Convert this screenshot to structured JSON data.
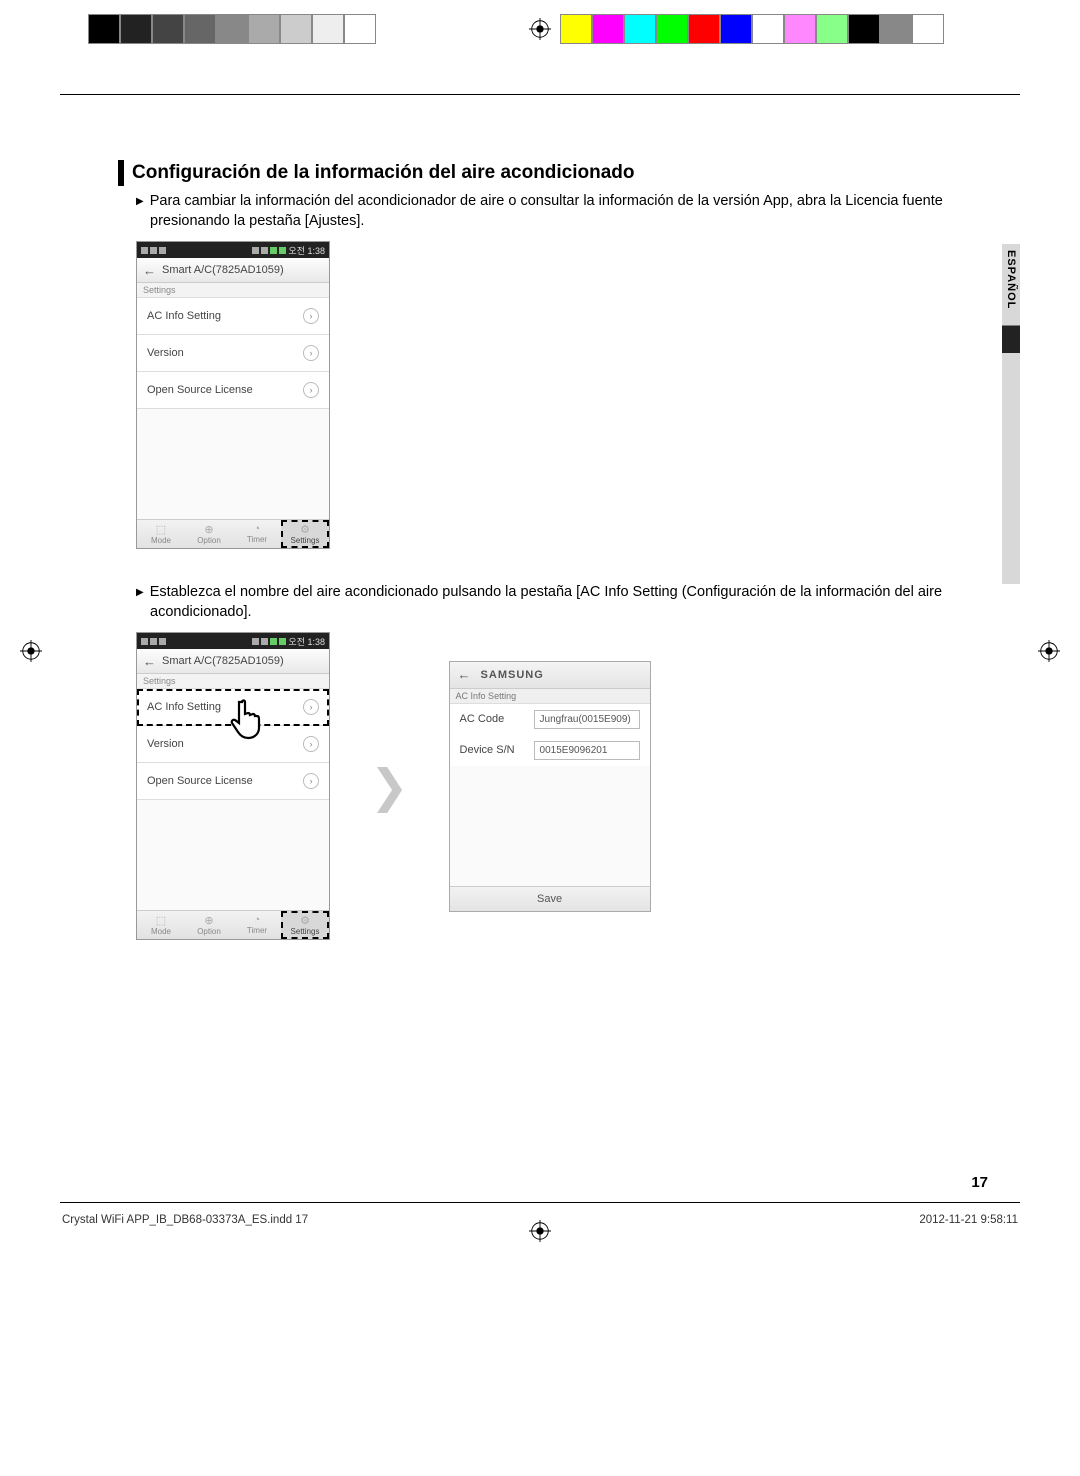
{
  "heading": "Configuración de la información del aire acondicionado",
  "para1": "Para cambiar la información del acondicionador de aire o consultar la información de la versión App, abra la Licencia fuente presionando la pestaña [Ajustes].",
  "para2": "Establezca el nombre del aire acondicionado pulsando la pestaña [AC Info Setting (Configuración de la información del aire acondicionado].",
  "langTab": "ESPAÑOL",
  "pageNum": "17",
  "footerLeft": "Crystal WiFi APP_IB_DB68-03373A_ES.indd   17",
  "footerRight": "2012-11-21   9:58:11",
  "phone": {
    "statusTime": "오전 1:38",
    "title": "Smart A/C(7825AD1059)",
    "subtitle": "Settings",
    "items": [
      "AC Info Setting",
      "Version",
      "Open Source License"
    ],
    "tabs": [
      "Mode",
      "Option",
      "Timer",
      "Settings"
    ]
  },
  "detail": {
    "brand": "SAMSUNG",
    "subtitle": "AC Info Setting",
    "rows": [
      {
        "label": "AC Code",
        "value": "Jungfrau(0015E909)"
      },
      {
        "label": "Device S/N",
        "value": "0015E9096201"
      }
    ],
    "save": "Save"
  },
  "colorbar_left": [
    "#000",
    "#222",
    "#444",
    "#666",
    "#888",
    "#aaa",
    "#ccc",
    "#eee",
    "#fff"
  ],
  "colorbar_right": [
    "#ff0",
    "#f0f",
    "#0ff",
    "#0f0",
    "#f00",
    "#00f",
    "#fff",
    "#f8f",
    "#8f8",
    "#000",
    "#888",
    "#fff"
  ]
}
